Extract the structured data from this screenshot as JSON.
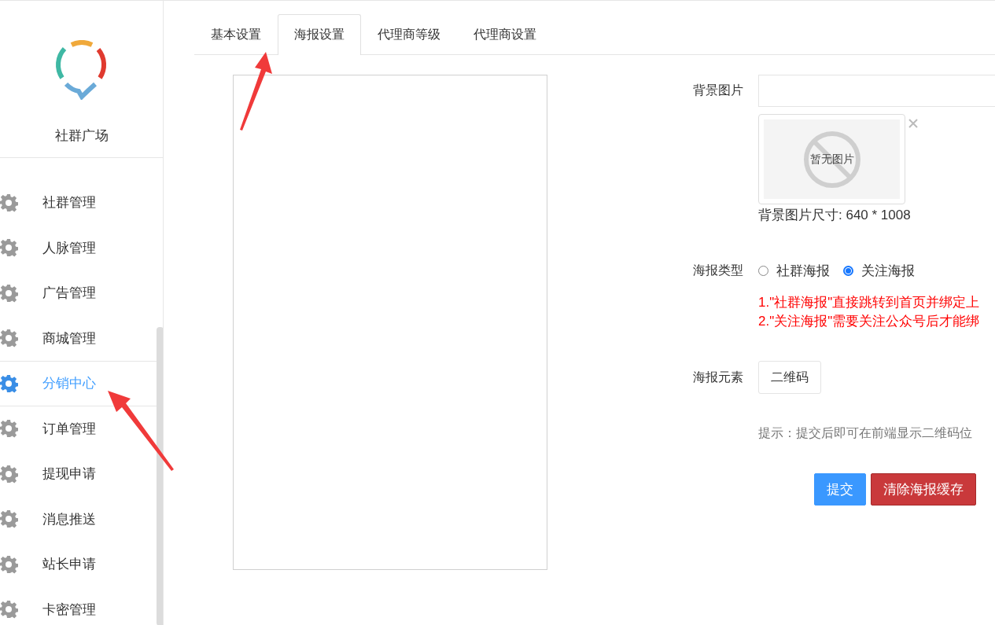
{
  "sidebar": {
    "brand": "社群广场",
    "items": [
      {
        "label": "社群管理",
        "selected": false
      },
      {
        "label": "人脉管理",
        "selected": false
      },
      {
        "label": "广告管理",
        "selected": false
      },
      {
        "label": "商城管理",
        "selected": false
      },
      {
        "label": "分销中心",
        "selected": true
      },
      {
        "label": "订单管理",
        "selected": false
      },
      {
        "label": "提现申请",
        "selected": false
      },
      {
        "label": "消息推送",
        "selected": false
      },
      {
        "label": "站长申请",
        "selected": false
      },
      {
        "label": "卡密管理",
        "selected": false
      }
    ]
  },
  "tabs": [
    {
      "label": "基本设置",
      "selected": false
    },
    {
      "label": "海报设置",
      "selected": true
    },
    {
      "label": "代理商等级",
      "selected": false
    },
    {
      "label": "代理商设置",
      "selected": false
    }
  ],
  "form": {
    "background": {
      "label": "背景图片",
      "empty_text": "暂无图片",
      "size_hint": "背景图片尺寸: 640 * 1008"
    },
    "poster_type": {
      "label": "海报类型",
      "options": [
        {
          "label": "社群海报",
          "selected": false
        },
        {
          "label": "关注海报",
          "selected": true
        }
      ],
      "notes": [
        "1.\"社群海报\"直接跳转到首页并绑定上",
        "2.\"关注海报\"需要关注公众号后才能绑"
      ]
    },
    "elements": {
      "label": "海报元素",
      "buttons": [
        "二维码"
      ]
    },
    "tip": "提示：提交后即可在前端显示二维码位",
    "actions": [
      {
        "label": "提交",
        "kind": "primary"
      },
      {
        "label": "清除海报缓存",
        "kind": "danger"
      }
    ]
  }
}
